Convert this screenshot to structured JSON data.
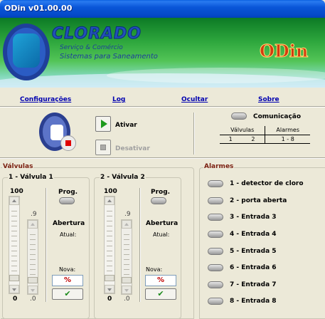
{
  "window": {
    "title": "ODin v01.00.00"
  },
  "banner": {
    "brand": "CLORADO",
    "line1": "Serviço & Comércio",
    "line2": "Sistemas para Saneamento",
    "product": "ODin"
  },
  "menu": [
    "Configurações",
    "Log",
    "Ocultar",
    "Sobre"
  ],
  "controls": {
    "activate": "Ativar",
    "deactivate": "Desativar"
  },
  "communication": {
    "label": "Comunicação",
    "headers": [
      "Válvulas",
      "Alarmes"
    ],
    "valves": [
      "1",
      "2"
    ],
    "alarms": "1 - 8"
  },
  "valves_group": {
    "title": "Válvulas",
    "valves": [
      {
        "title": "1 - Válvula 1",
        "max": "100",
        "min": "0",
        "aux_max": ".9",
        "aux_min": ".0",
        "prog": "Prog.",
        "abertura": "Abertura",
        "atual": "Atual:",
        "nova": "Nova:",
        "input": "%",
        "confirm": "✔"
      },
      {
        "title": "2 - Válvula 2",
        "max": "100",
        "min": "0",
        "aux_max": ".9",
        "aux_min": ".0",
        "prog": "Prog.",
        "abertura": "Abertura",
        "atual": "Atual:",
        "nova": "Nova:",
        "input": "%",
        "confirm": "✔"
      }
    ]
  },
  "alarms_group": {
    "title": "Alarmes",
    "items": [
      "1 - detector de cloro",
      "2 - porta aberta",
      "3 - Entrada 3",
      "4 - Entrada 4",
      "5 - Entrada 5",
      "6 - Entrada 6",
      "7 - Entrada 7",
      "8 - Entrada 8"
    ]
  }
}
